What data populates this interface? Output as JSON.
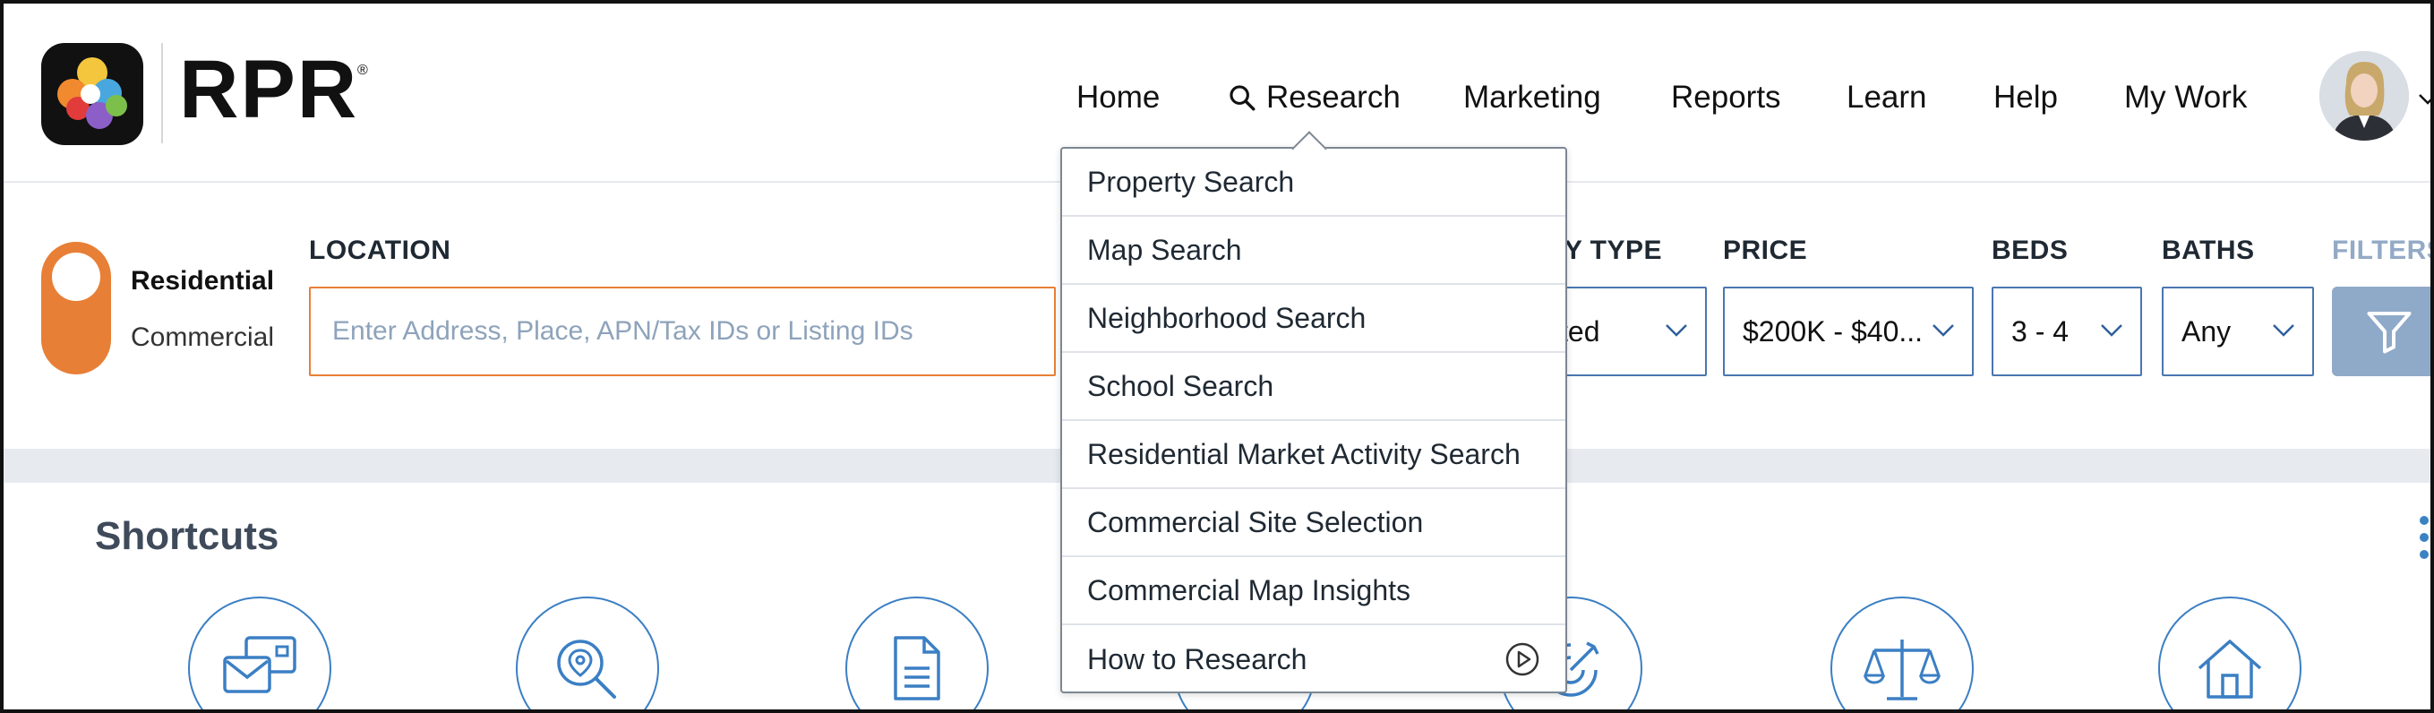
{
  "brand": {
    "name": "RPR",
    "registered": "®"
  },
  "nav": {
    "items": [
      "Home",
      "Research",
      "Marketing",
      "Reports",
      "Learn",
      "Help",
      "My Work"
    ]
  },
  "search": {
    "property_class": {
      "selected": "Residential",
      "other": "Commercial"
    },
    "location": {
      "label": "LOCATION",
      "placeholder": "Enter Address, Place, APN/Tax IDs or Listing IDs"
    },
    "property_type": {
      "label": "TY TYPE",
      "value": "ted"
    },
    "price": {
      "label": "PRICE",
      "value": "$200K - $40..."
    },
    "beds": {
      "label": "BEDS",
      "value": "3 - 4"
    },
    "baths": {
      "label": "BATHS",
      "value": "Any"
    },
    "filters": {
      "label": "FILTERS"
    }
  },
  "research_menu": {
    "items": [
      "Property Search",
      "Map Search",
      "Neighborhood Search",
      "School Search",
      "Residential Market Activity Search",
      "Commercial Site Selection",
      "Commercial Map Insights",
      "How to Research"
    ]
  },
  "shortcuts": {
    "title": "Shortcuts",
    "icons": [
      "mail-cards-icon",
      "map-search-icon",
      "document-icon",
      "hidden-icon",
      "target-icon",
      "scales-icon",
      "home-icon"
    ]
  },
  "colors": {
    "accent_orange": "#e87f36",
    "link_blue": "#3b7fc4",
    "filter_blue": "#8fa9c9"
  }
}
